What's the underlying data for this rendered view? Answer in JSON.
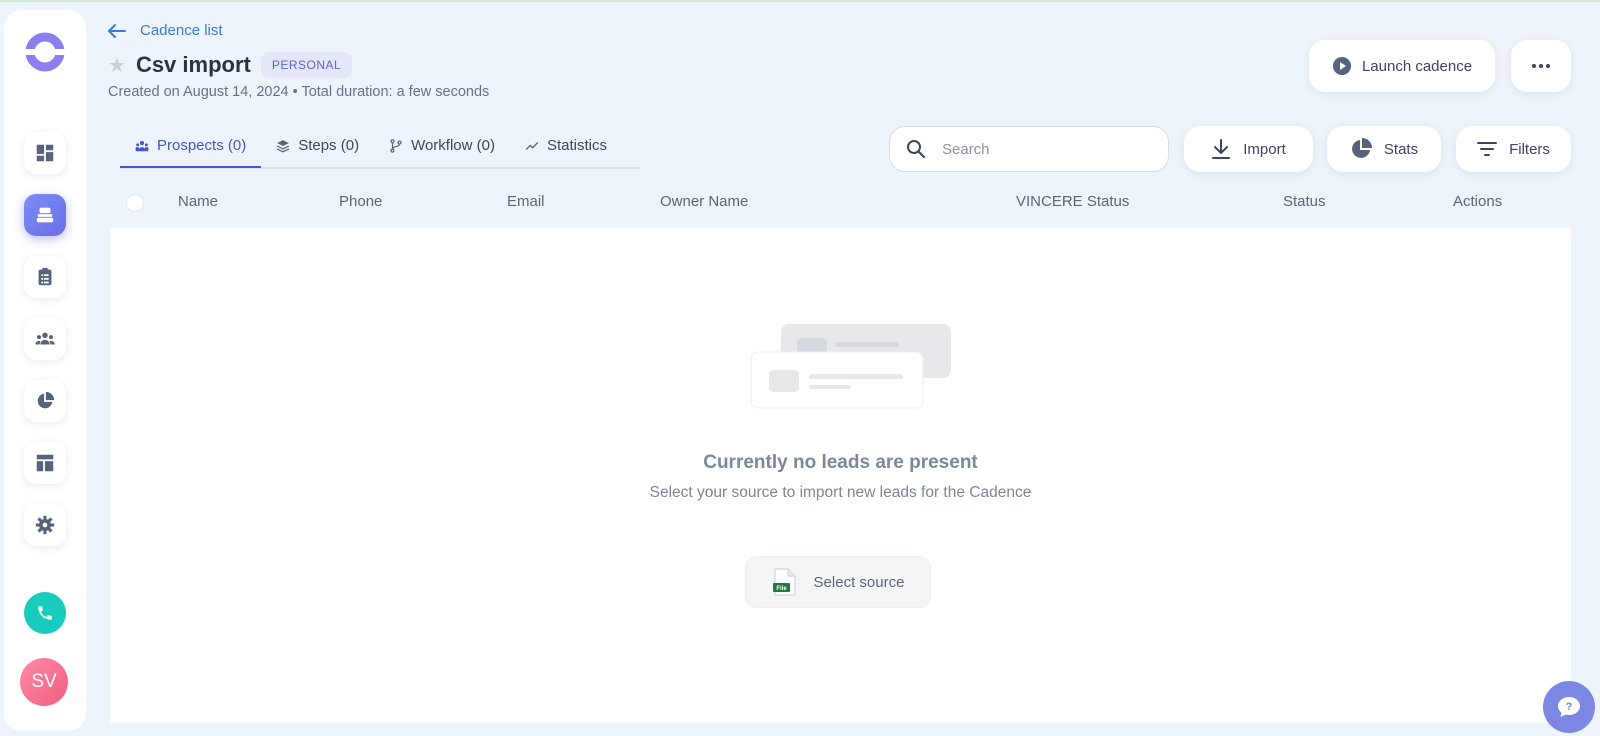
{
  "header": {
    "back_label": "Cadence list",
    "title": "Csv import",
    "badge": "PERSONAL",
    "meta": "Created on August 14, 2024 • Total duration: a few seconds",
    "launch_label": "Launch cadence"
  },
  "tabs": [
    {
      "label": "Prospects (0)",
      "icon": "people-icon",
      "active": true
    },
    {
      "label": "Steps (0)",
      "icon": "layers-icon"
    },
    {
      "label": "Workflow (0)",
      "icon": "branch-icon"
    },
    {
      "label": "Statistics",
      "icon": "trend-icon"
    }
  ],
  "toolbar": {
    "search_placeholder": "Search",
    "import_label": "Import",
    "stats_label": "Stats",
    "filters_label": "Filters"
  },
  "table": {
    "columns": [
      "Name",
      "Phone",
      "Email",
      "Owner Name",
      "VINCERE Status",
      "Status",
      "Actions"
    ]
  },
  "empty": {
    "title": "Currently no leads are present",
    "subtitle": "Select your source to import new leads for the Cadence",
    "select_source_label": "Select source",
    "file_icon_text": "File"
  },
  "sidebar": {
    "items": [
      "dashboard-icon",
      "cadence-icon",
      "tasks-icon",
      "people-icon",
      "reports-icon",
      "templates-icon",
      "settings-icon"
    ],
    "avatar": "SV"
  },
  "colors": {
    "accent": "#4457c8",
    "sidebar_active": "#6a6de8",
    "phone": "#17ccbd",
    "avatar": "#f25c83",
    "help": "#7b87e3"
  }
}
